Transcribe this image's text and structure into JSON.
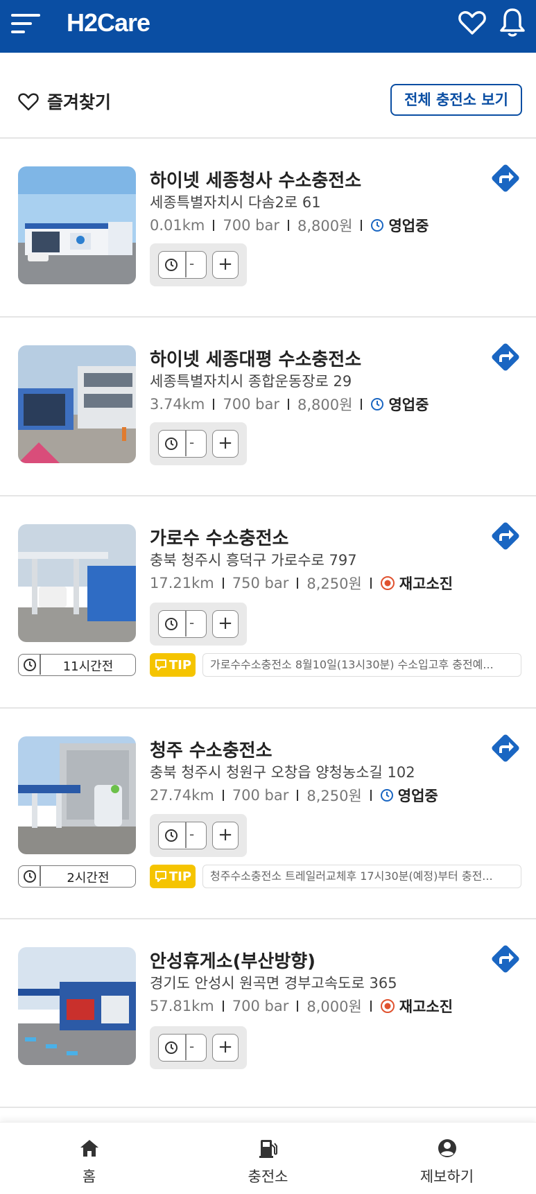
{
  "header": {
    "logo": "H2Care",
    "icons": [
      "menu-icon",
      "heart-icon",
      "bell-icon"
    ]
  },
  "favorites": {
    "label": "즐겨찾기",
    "all_button": "전체 충전소 보기"
  },
  "stations": [
    {
      "name": "하이넷 세종청사 수소충전소",
      "address": "세종특별자치시 다솜2로 61",
      "distance": "0.01km",
      "pressure": "700 bar",
      "price": "8,800원",
      "status": "영업중",
      "status_type": "open"
    },
    {
      "name": "하이넷 세종대평 수소충전소",
      "address": "세종특별자치시 종합운동장로 29",
      "distance": "3.74km",
      "pressure": "700 bar",
      "price": "8,800원",
      "status": "영업중",
      "status_type": "open"
    },
    {
      "name": "가로수 수소충전소",
      "address": "충북 청주시 흥덕구 가로수로 797",
      "distance": "17.21km",
      "pressure": "750 bar",
      "price": "8,250원",
      "status": "재고소진",
      "status_type": "soldout",
      "updated": "11시간전",
      "tip_label": "TIP",
      "tip": "가로수수소충전소 8월10일(13시30분) 수소입고후 충전예..."
    },
    {
      "name": "청주 수소충전소",
      "address": "충북 청주시 청원구 오창읍 양청농소길 102",
      "distance": "27.74km",
      "pressure": "700 bar",
      "price": "8,250원",
      "status": "영업중",
      "status_type": "open",
      "updated": "2시간전",
      "tip_label": "TIP",
      "tip": "청주수소충전소 트레일러교체후 17시30분(예정)부터 충전..."
    },
    {
      "name": "안성휴게소(부산방향)",
      "address": "경기도 안성시 원곡면 경부고속도로 365",
      "distance": "57.81km",
      "pressure": "700 bar",
      "price": "8,000원",
      "status": "재고소진",
      "status_type": "soldout"
    }
  ],
  "controls": {
    "minus": "-",
    "plus": "+"
  },
  "bottom_nav": [
    {
      "label": "홈",
      "icon": "home-icon"
    },
    {
      "label": "충전소",
      "icon": "fuel-station-icon"
    },
    {
      "label": "제보하기",
      "icon": "user-circle-icon"
    }
  ],
  "colors": {
    "brand": "#0a4ea3",
    "open": "#1a66c2",
    "soldout": "#e0522f",
    "tip": "#f5c400"
  }
}
